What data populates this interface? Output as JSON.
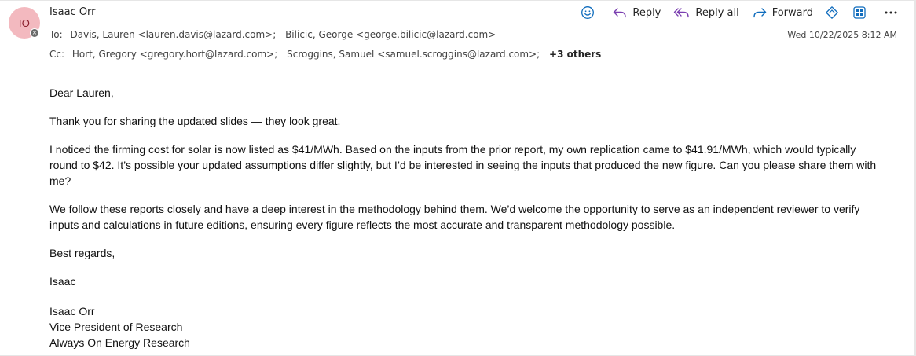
{
  "sender": {
    "initials": "IO",
    "name": "Isaac Orr"
  },
  "toolbar": {
    "emoji_icon": "emoji-smile-icon",
    "reply_label": "Reply",
    "reply_all_label": "Reply all",
    "forward_label": "Forward",
    "more_icon": "more-horizontal-icon"
  },
  "header": {
    "to_label": "To:",
    "to": [
      "Davis, Lauren <lauren.davis@lazard.com>;",
      "Bilicic, George <george.bilicic@lazard.com>"
    ],
    "cc_label": "Cc:",
    "cc": [
      "Hort, Gregory <gregory.hort@lazard.com>;",
      "Scroggins, Samuel <samuel.scroggins@lazard.com>;"
    ],
    "cc_more": "+3 others",
    "date": "Wed 10/22/2025 8:12 AM"
  },
  "body": {
    "greeting": "Dear Lauren,",
    "p1": "Thank you for sharing the updated slides — they look great.",
    "p2": "I noticed the firming cost for solar is now listed as $41/MWh. Based on the inputs from the prior report, my own replication came to $41.91/MWh, which would typically round to $42. It’s possible your updated assumptions differ slightly, but I’d be interested in seeing the inputs that produced the new figure. Can you please share them with me?",
    "p3": "We follow these reports closely and have a deep interest in the methodology behind them. We’d welcome the opportunity to serve as an independent reviewer to verify inputs and calculations in future editions, ensuring every figure reflects the most accurate and transparent methodology possible.",
    "closing": "Best regards,",
    "name_short": "Isaac",
    "signature": {
      "name": "Isaac Orr",
      "title": "Vice President of Research",
      "org": "Always On Energy Research"
    }
  },
  "colors": {
    "avatar_bg": "#f3b9bf",
    "avatar_text": "#8a1f2c",
    "reply_all_accent": "#7a3fb0",
    "forward_accent": "#0f6cbd"
  }
}
